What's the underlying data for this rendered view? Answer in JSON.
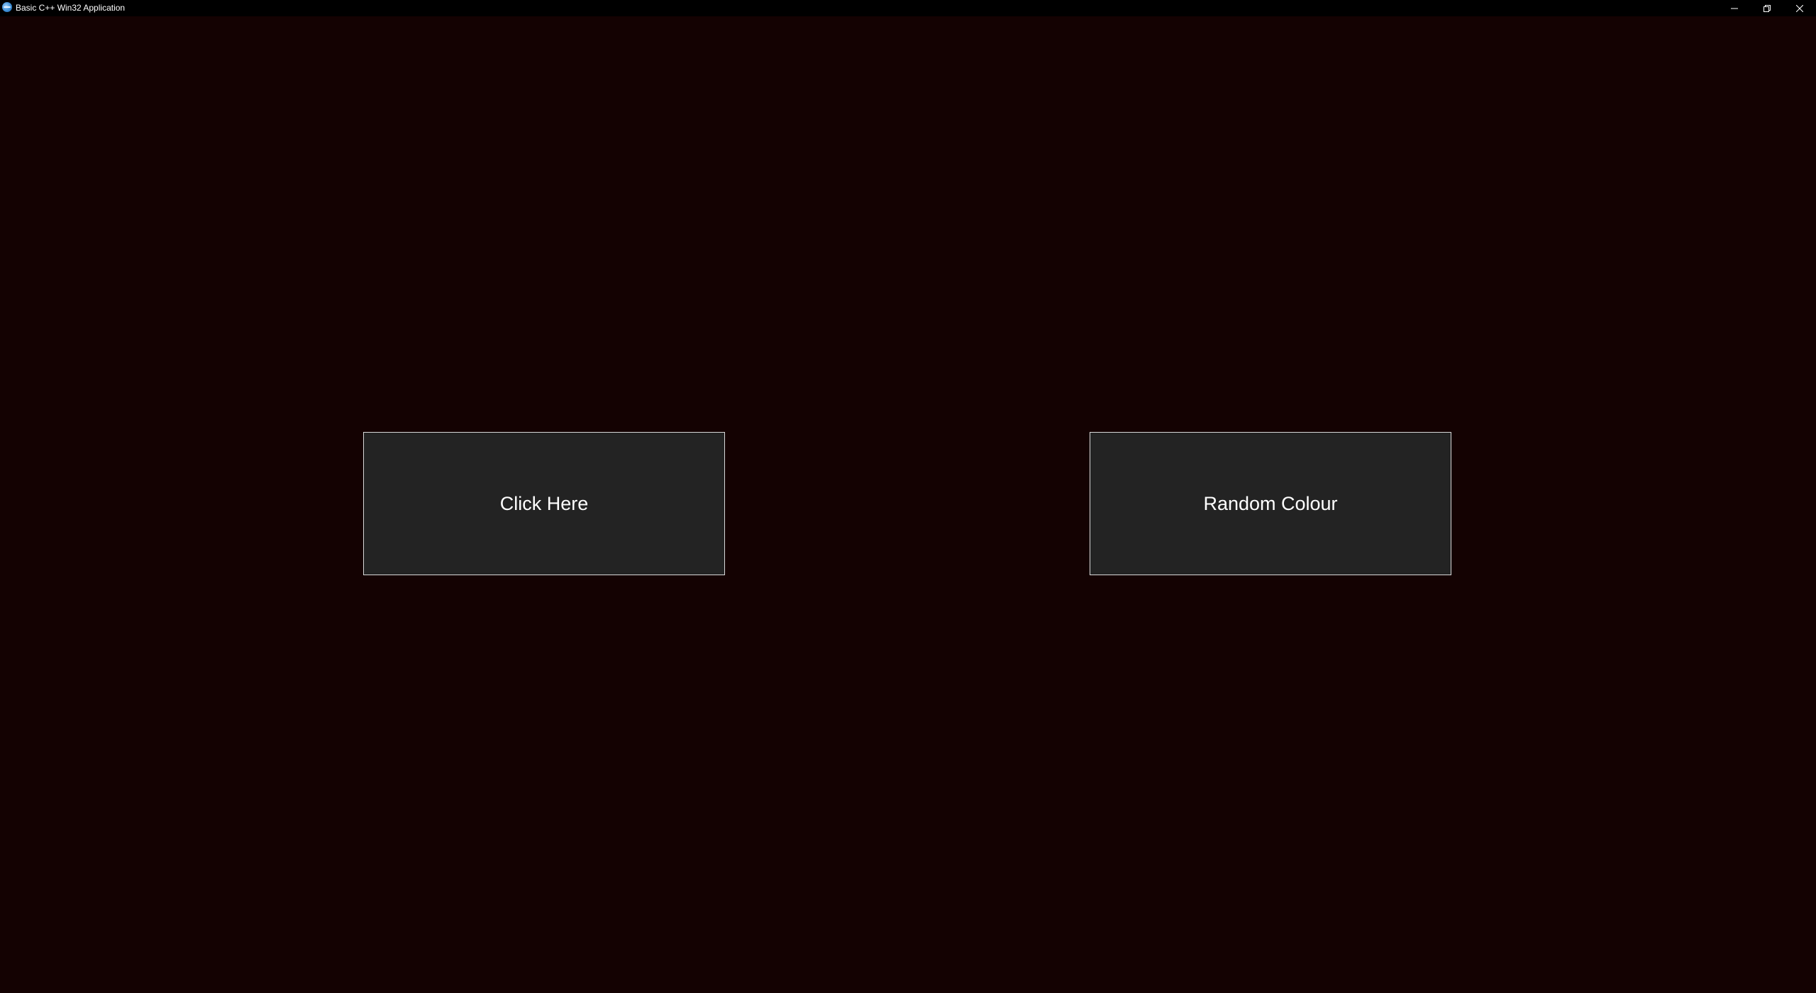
{
  "window": {
    "title": "Basic C++ Win32 Application",
    "icon": "app-globe-icon",
    "controls": [
      "minimize-icon",
      "restore-icon",
      "close-icon"
    ]
  },
  "colors": {
    "client_background": "#140202",
    "titlebar_background": "#000000",
    "button_background": "#232323",
    "button_border": "#d8d8d8",
    "button_text": "#ffffff"
  },
  "buttons": {
    "click_here_label": "Click Here",
    "random_colour_label": "Random Colour"
  }
}
